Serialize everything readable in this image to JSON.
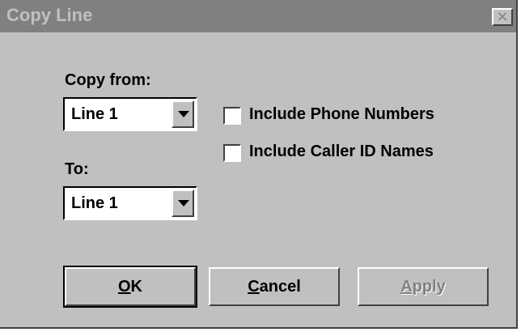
{
  "window": {
    "title": "Copy Line",
    "close_glyph": "×"
  },
  "copy_from": {
    "label": "Copy from:",
    "selected": "Line 1"
  },
  "copy_to": {
    "label": "To:",
    "selected": "Line 1"
  },
  "options": [
    {
      "label": "Include Phone Numbers",
      "checked": false
    },
    {
      "label": "Include Caller ID Names",
      "checked": false
    }
  ],
  "buttons": {
    "ok": {
      "mnemonic": "O",
      "rest": "K",
      "enabled": true
    },
    "cancel": {
      "mnemonic": "C",
      "rest": "ancel",
      "enabled": true
    },
    "apply": {
      "mnemonic": "A",
      "rest": "pply",
      "enabled": false
    }
  }
}
